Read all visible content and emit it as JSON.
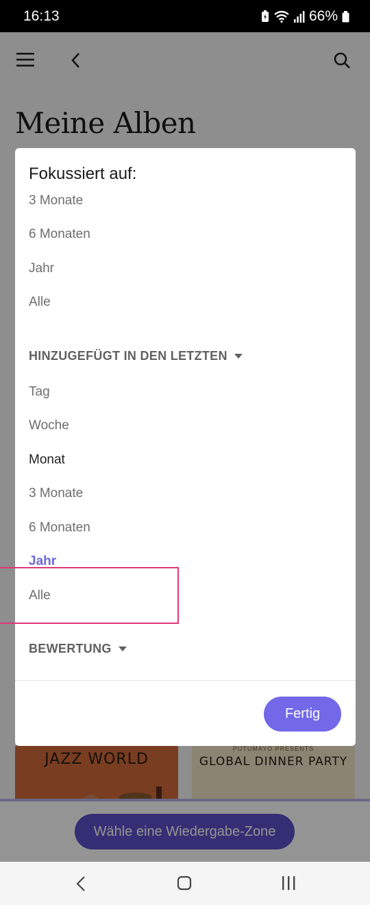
{
  "status_bar": {
    "time": "16:13",
    "battery": "66%"
  },
  "app": {
    "title": "Meine Alben",
    "albums": [
      {
        "title": "JAZZ WORLD",
        "kicker": ""
      },
      {
        "title": "GLOBAL DINNER PARTY",
        "kicker": "PUTUMAYO PRESENTS"
      }
    ],
    "zone_button_label": "Wähle eine Wiedergabe-Zone"
  },
  "dialog": {
    "heading": "Fokussiert auf:",
    "focus_options": [
      "3 Monate",
      "6 Monaten",
      "Jahr",
      "Alle"
    ],
    "added_section": {
      "label": "HINZUGEFÜGT IN DEN LETZTEN",
      "options": [
        "Tag",
        "Woche",
        "Monat",
        "3 Monate",
        "6 Monaten",
        "Jahr",
        "Alle"
      ],
      "highlighted_option": "Monat",
      "accent_option": "Jahr"
    },
    "rating_section": {
      "label": "BEWERTUNG"
    },
    "done_label": "Fertig"
  },
  "colors": {
    "accent": "#6e67d8",
    "button": "#7268e8",
    "zone_button": "#5a52c8",
    "highlight_border": "#e0367a"
  },
  "icons": [
    "menu-icon",
    "back-icon",
    "search-icon",
    "battery-saver-icon",
    "wifi-icon",
    "signal-icon",
    "battery-icon",
    "nav-back-icon",
    "nav-home-icon",
    "nav-recents-icon"
  ]
}
